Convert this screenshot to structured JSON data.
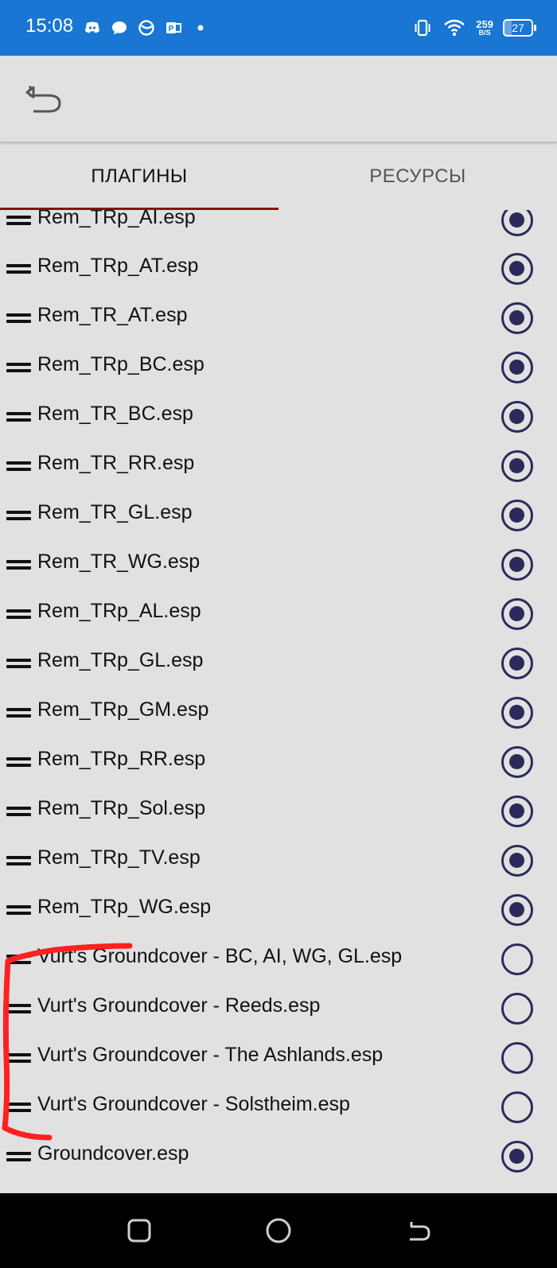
{
  "status_bar": {
    "time": "15:08",
    "net_speed_value": "259",
    "net_speed_unit": "B/S",
    "battery_percent": "27",
    "left_icons": [
      "discord-icon",
      "chat-icon",
      "app-icon",
      "outlook-icon",
      "dot-icon"
    ],
    "right_icons": [
      "vibrate-icon",
      "wifi-icon"
    ]
  },
  "toolbar": {
    "back_icon": "back-arrow-icon"
  },
  "tabs": [
    {
      "label": "ПЛАГИНЫ",
      "active": true
    },
    {
      "label": "РЕСУРСЫ",
      "active": false
    }
  ],
  "plugins": [
    {
      "name": "Rem_TRp_AI.esp",
      "enabled": true
    },
    {
      "name": "Rem_TRp_AT.esp",
      "enabled": true
    },
    {
      "name": "Rem_TR_AT.esp",
      "enabled": true
    },
    {
      "name": "Rem_TRp_BC.esp",
      "enabled": true
    },
    {
      "name": "Rem_TR_BC.esp",
      "enabled": true
    },
    {
      "name": "Rem_TR_RR.esp",
      "enabled": true
    },
    {
      "name": "Rem_TR_GL.esp",
      "enabled": true
    },
    {
      "name": "Rem_TR_WG.esp",
      "enabled": true
    },
    {
      "name": "Rem_TRp_AL.esp",
      "enabled": true
    },
    {
      "name": "Rem_TRp_GL.esp",
      "enabled": true
    },
    {
      "name": "Rem_TRp_GM.esp",
      "enabled": true
    },
    {
      "name": "Rem_TRp_RR.esp",
      "enabled": true
    },
    {
      "name": "Rem_TRp_Sol.esp",
      "enabled": true
    },
    {
      "name": "Rem_TRp_TV.esp",
      "enabled": true
    },
    {
      "name": "Rem_TRp_WG.esp",
      "enabled": true
    },
    {
      "name": "Vurt's Groundcover - BC, AI, WG, GL.esp",
      "enabled": false
    },
    {
      "name": "Vurt's Groundcover - Reeds.esp",
      "enabled": false
    },
    {
      "name": "Vurt's Groundcover - The Ashlands.esp",
      "enabled": false
    },
    {
      "name": "Vurt's Groundcover - Solstheim.esp",
      "enabled": false
    },
    {
      "name": "Groundcover.esp",
      "enabled": true
    }
  ],
  "colors": {
    "status_bar": "#1976d2",
    "background": "#e1e1e1",
    "tab_indicator": "#8a1111",
    "radio": "#2b2a5a",
    "annotation": "#ff2020"
  },
  "nav_bar": {
    "icons": [
      "recents-square-icon",
      "home-circle-icon",
      "back-icon"
    ]
  }
}
